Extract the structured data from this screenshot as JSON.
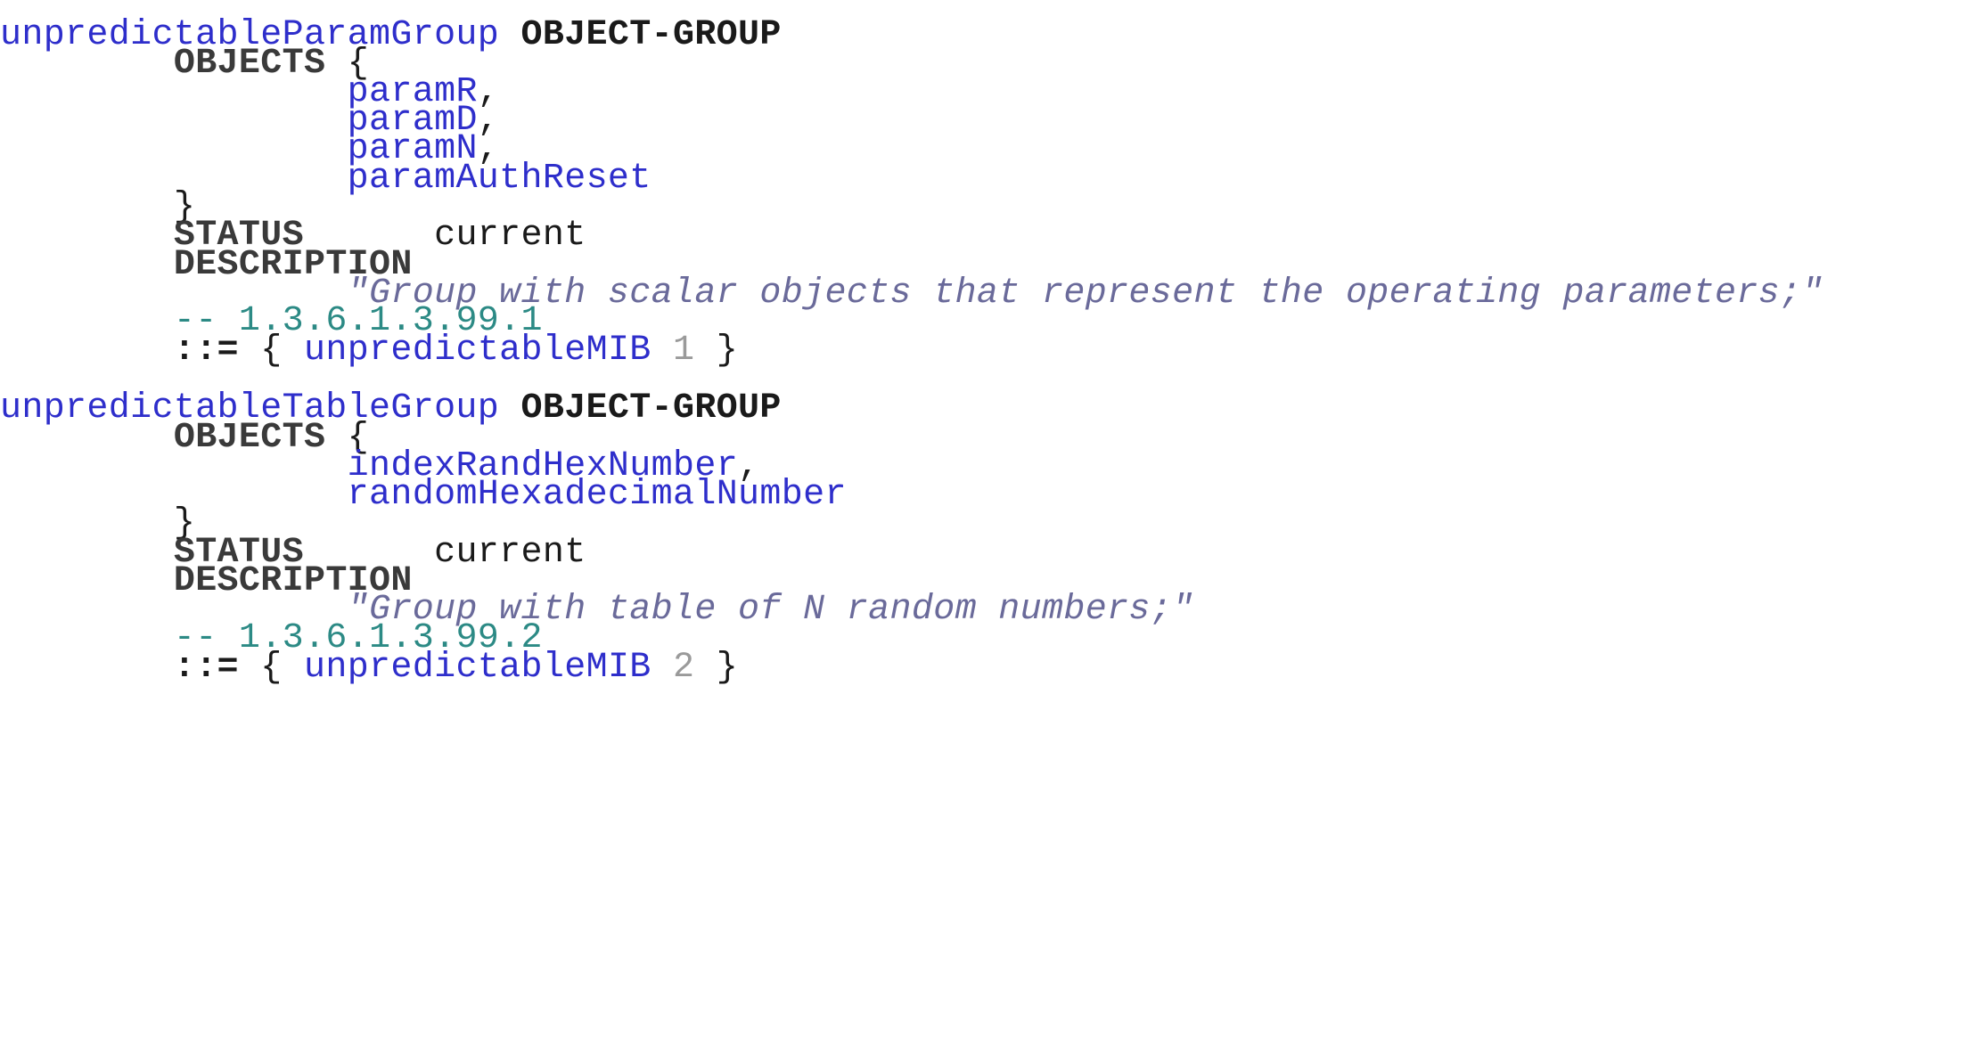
{
  "groups": [
    {
      "name": "unpredictableParamGroup",
      "macro": "OBJECT-GROUP",
      "objects_keyword": "OBJECTS",
      "objects": [
        "paramR",
        "paramD",
        "paramN",
        "paramAuthReset"
      ],
      "status_keyword": "STATUS",
      "status": "current",
      "description_keyword": "DESCRIPTION",
      "description": "\"Group with scalar objects that represent the operating parameters;\"",
      "oid_comment": "-- 1.3.6.1.3.99.1",
      "assign": "::=",
      "parent": "unpredictableMIB",
      "sub_id": "1"
    },
    {
      "name": "unpredictableTableGroup",
      "macro": "OBJECT-GROUP",
      "objects_keyword": "OBJECTS",
      "objects": [
        "indexRandHexNumber",
        "randomHexadecimalNumber"
      ],
      "status_keyword": "STATUS",
      "status": "current",
      "description_keyword": "DESCRIPTION",
      "description": "\"Group with table of N random numbers;\"",
      "oid_comment": "-- 1.3.6.1.3.99.2",
      "assign": "::=",
      "parent": "unpredictableMIB",
      "sub_id": "2"
    }
  ]
}
